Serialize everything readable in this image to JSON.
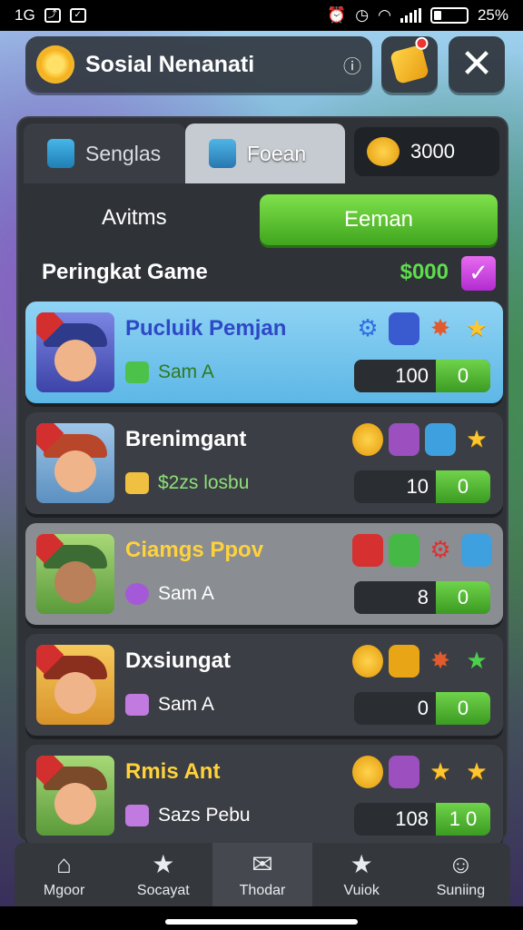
{
  "status_bar": {
    "left_text": "1G",
    "battery": "25%",
    "battery_level": 0.25
  },
  "header": {
    "title": "Sosial Nenanati",
    "info_icon": "info-icon",
    "badge_icon": "badge-icon",
    "close_icon": "close-icon"
  },
  "tabs": [
    {
      "label": "Senglas",
      "icon": "lock-icon"
    },
    {
      "label": "Foean",
      "icon": "runner-icon",
      "active": true
    }
  ],
  "coins": {
    "value": "3000",
    "icon": "coin-face-icon"
  },
  "filters": {
    "label": "Avitms",
    "button": "Eeman"
  },
  "ranking": {
    "title": "Peringkat Game",
    "price": "$000",
    "check_icon": "check-icon"
  },
  "players": [
    {
      "name": "Pucluik Pemjan",
      "sub": "Sam A",
      "score": "100",
      "extra": "0",
      "style": "highlight"
    },
    {
      "name": "Brenimgant",
      "sub": "$2zs losbu",
      "score": "10",
      "extra": "0",
      "style": "normal"
    },
    {
      "name": "Ciamgs Ppov",
      "sub": "Sam A",
      "score": "8",
      "extra": "0",
      "style": "alt"
    },
    {
      "name": "Dxsiungat",
      "sub": "Sam A",
      "score": "0",
      "extra": "0",
      "style": "normal"
    },
    {
      "name": "Rmis Ant",
      "sub": "Sazs Pebu",
      "score": "108",
      "extra": "1 0",
      "style": "normal"
    }
  ],
  "nav": [
    {
      "label": "Mgoor",
      "icon": "home-icon"
    },
    {
      "label": "Socayat",
      "icon": "star-icon"
    },
    {
      "label": "Thodar",
      "icon": "envelope-icon",
      "active": true
    },
    {
      "label": "Vuiok",
      "icon": "star-badge-icon"
    },
    {
      "label": "Suniing",
      "icon": "person-icon"
    }
  ],
  "colors": {
    "accent_green": "#4fbf2a",
    "highlight_blue": "#6cc3ee",
    "price_green": "#5edc4e",
    "panel": "#2f3237"
  }
}
